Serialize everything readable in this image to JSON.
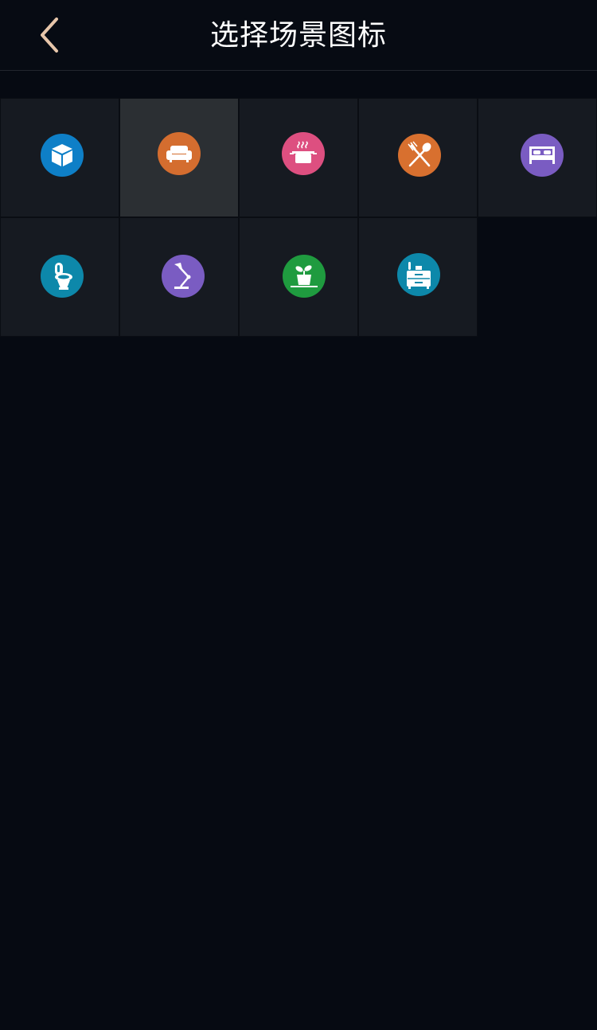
{
  "header": {
    "title": "选择场景图标"
  },
  "icons": [
    {
      "name": "cube-icon",
      "color": "#0e7fc7",
      "selected": false
    },
    {
      "name": "sofa-icon",
      "color": "#d46d2f",
      "selected": true
    },
    {
      "name": "cooking-pot-icon",
      "color": "#dd4f80",
      "selected": false
    },
    {
      "name": "fork-spoon-icon",
      "color": "#d8702f",
      "selected": false
    },
    {
      "name": "bed-icon",
      "color": "#7a5cc2",
      "selected": false
    },
    {
      "name": "toilet-icon",
      "color": "#0d88aa",
      "selected": false
    },
    {
      "name": "desk-lamp-icon",
      "color": "#7a5cc2",
      "selected": false
    },
    {
      "name": "potted-plant-icon",
      "color": "#1f9b3f",
      "selected": false
    },
    {
      "name": "nightstand-icon",
      "color": "#0d88aa",
      "selected": false
    }
  ]
}
